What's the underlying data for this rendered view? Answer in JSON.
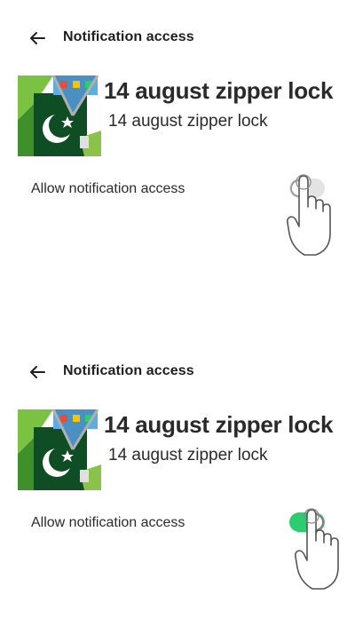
{
  "screens": [
    {
      "header": {
        "title": "Notification access",
        "back_icon": "arrow-left-icon"
      },
      "app": {
        "name_large": "14 august zipper lock",
        "name_small": "14 august zipper lock"
      },
      "permission": {
        "label": "Allow notification access",
        "enabled": false
      },
      "gesture_icon": "pointing-hand-icon"
    },
    {
      "header": {
        "title": "Notification access",
        "back_icon": "arrow-left-icon"
      },
      "app": {
        "name_large": "14 august zipper lock",
        "name_small": "14 august zipper lock"
      },
      "permission": {
        "label": "Allow notification access",
        "enabled": true
      },
      "gesture_icon": "pointing-hand-icon"
    }
  ],
  "colors": {
    "toggle_on": "#2ecc71",
    "toggle_off": "#e3e3e3",
    "text": "#1f1f1f"
  }
}
